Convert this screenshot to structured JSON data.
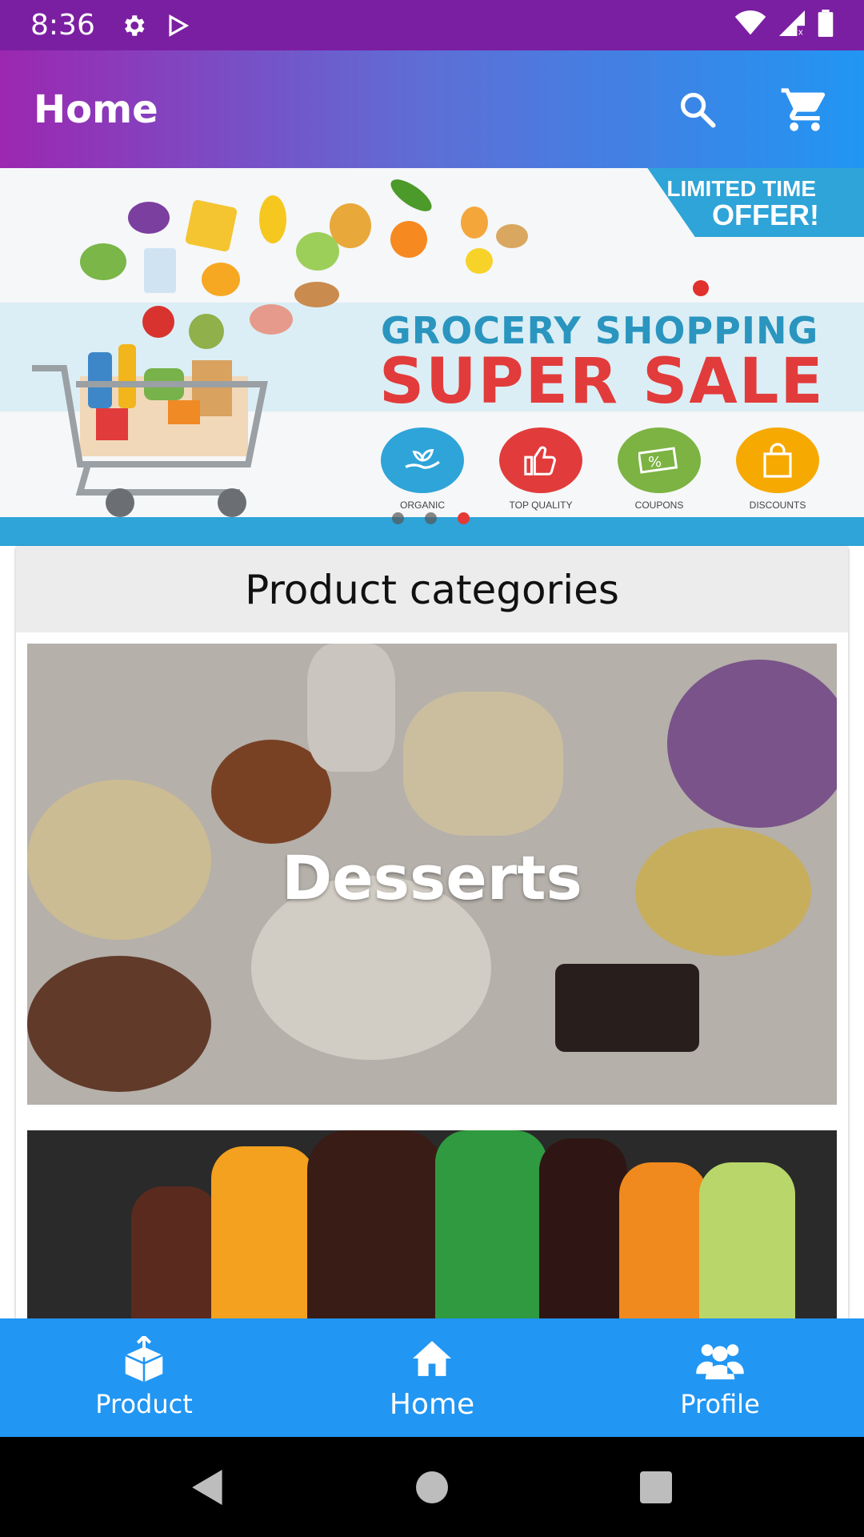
{
  "status_bar": {
    "time": "8:36",
    "icons_left": [
      "settings-icon",
      "play-store-icon"
    ],
    "icons_right": [
      "wifi-icon",
      "signal-icon",
      "battery-icon"
    ]
  },
  "app_bar": {
    "title": "Home",
    "actions": [
      "search-icon",
      "cart-icon"
    ]
  },
  "banner": {
    "offer_line1": "LIMITED TIME",
    "offer_line2": "OFFER!",
    "title_line1": "GROCERY SHOPPING",
    "title_line2": "SUPER SALE",
    "features": [
      {
        "label": "ORGANIC",
        "color": "#2ea4d8",
        "icon": "hand-plant-icon"
      },
      {
        "label": "TOP QUALITY",
        "color": "#e23b3b",
        "icon": "thumbs-up-icon"
      },
      {
        "label": "COUPONS",
        "color": "#7cb342",
        "icon": "coupon-icon"
      },
      {
        "label": "DISCOUNTS",
        "color": "#f6a900",
        "icon": "shopping-bag-icon"
      }
    ],
    "carousel": {
      "count": 3,
      "active_index": 2
    }
  },
  "categories": {
    "header": "Product categories",
    "items": [
      {
        "label": "Desserts"
      },
      {
        "label": ""
      }
    ]
  },
  "bottom_nav": {
    "items": [
      {
        "label": "Product",
        "icon": "box-icon",
        "active": false
      },
      {
        "label": "Home",
        "icon": "home-icon",
        "active": true
      },
      {
        "label": "Profile",
        "icon": "users-icon",
        "active": false
      }
    ]
  },
  "system_nav": [
    "back-icon",
    "home-circle-icon",
    "recents-icon"
  ],
  "colors": {
    "status_bar": "#7b1fa2",
    "app_bar_start": "#9c27b0",
    "app_bar_end": "#2196f3",
    "bottom_nav": "#2196f3",
    "carousel_active": "#e53935"
  }
}
